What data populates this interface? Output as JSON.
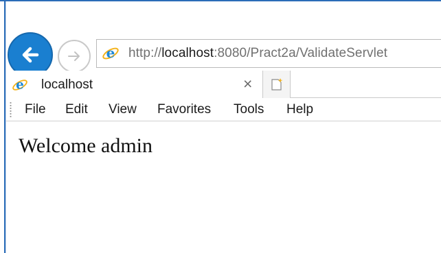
{
  "address_bar": {
    "url_prefix": "http://",
    "url_host": "localhost",
    "url_rest": ":8080/Pract2a/ValidateServlet"
  },
  "tab": {
    "title": "localhost",
    "close_glyph": "×"
  },
  "menu": {
    "items": [
      {
        "label": "File"
      },
      {
        "label": "Edit"
      },
      {
        "label": "View"
      },
      {
        "label": "Favorites"
      },
      {
        "label": "Tools"
      },
      {
        "label": "Help"
      }
    ]
  },
  "page": {
    "message": "Welcome admin"
  },
  "icons": {
    "back": "back-arrow-icon",
    "forward": "forward-arrow-icon",
    "browser": "internet-explorer-icon",
    "new_tab": "new-tab-icon"
  },
  "colors": {
    "accent": "#1a7fd0",
    "window_border": "#2b6cb8",
    "ie_blue": "#1e88d6",
    "ie_gold": "#f3b21a"
  }
}
